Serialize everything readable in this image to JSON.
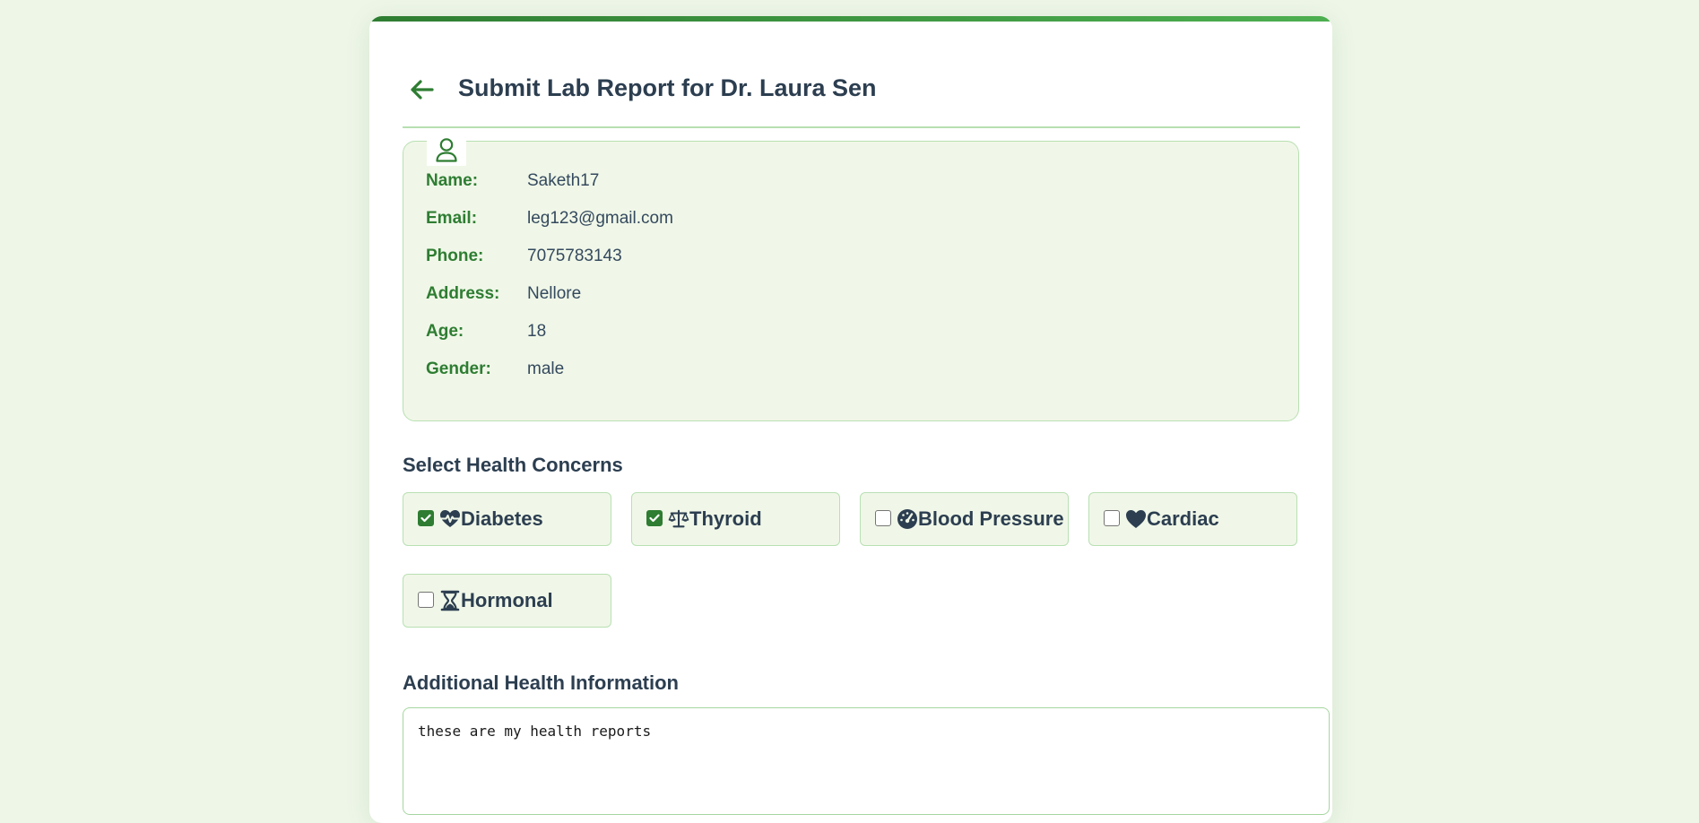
{
  "header": {
    "title": "Submit Lab Report for Dr. Laura Sen"
  },
  "patient": {
    "icon": "user-icon",
    "fields": [
      {
        "label": "Name:",
        "value": "Saketh17"
      },
      {
        "label": "Email:",
        "value": "leg123@gmail.com"
      },
      {
        "label": "Phone:",
        "value": "7075783143"
      },
      {
        "label": "Address:",
        "value": "Nellore"
      },
      {
        "label": "Age:",
        "value": "18"
      },
      {
        "label": "Gender:",
        "value": "male"
      }
    ]
  },
  "concerns": {
    "title": "Select Health Concerns",
    "items": [
      {
        "label": "Diabetes",
        "checked": true,
        "icon": "heart-pulse-icon"
      },
      {
        "label": "Thyroid",
        "checked": true,
        "icon": "scale-balanced-icon"
      },
      {
        "label": "Blood Pressure",
        "checked": false,
        "icon": "gauge-icon"
      },
      {
        "label": "Cardiac",
        "checked": false,
        "icon": "heart-icon"
      },
      {
        "label": "Hormonal",
        "checked": false,
        "icon": "hourglass-icon"
      }
    ]
  },
  "additional": {
    "title": "Additional Health Information",
    "value": "these are my health reports"
  },
  "colors": {
    "accent": "#2e7d32",
    "background": "#eef6e8",
    "panel": "#f0f7e8",
    "border": "#b9e0b3"
  }
}
